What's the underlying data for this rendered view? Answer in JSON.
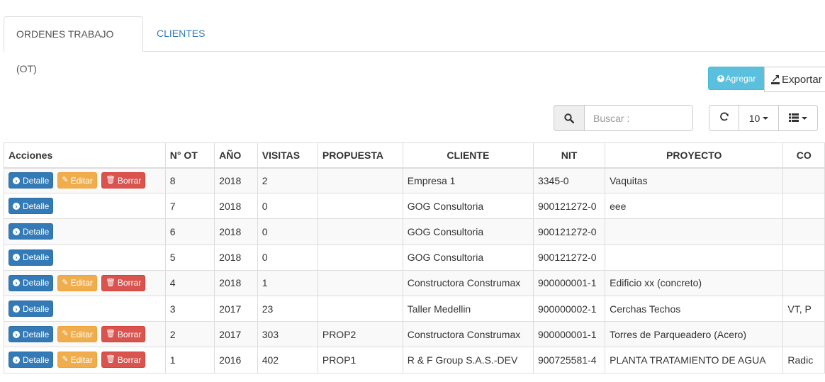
{
  "tabs": [
    {
      "label": "ORDENES TRABAJO (OT)",
      "active": true
    },
    {
      "label": "CLIENTES",
      "active": false
    }
  ],
  "toolbar": {
    "agregar_label": "Agregar",
    "exportar_label": "Exportar",
    "search_placeholder": "Buscar :",
    "page_size": "10"
  },
  "table": {
    "headers": [
      "Acciones",
      "N° OT",
      "AÑO",
      "VISITAS",
      "PROPUESTA",
      "CLIENTE",
      "NIT",
      "PROYECTO",
      "CO"
    ],
    "action_labels": {
      "detalle": "Detalle",
      "editar": "Editar",
      "borrar": "Borrar"
    },
    "rows": [
      {
        "editable": true,
        "ot": "8",
        "anio": "2018",
        "visitas": "2",
        "propuesta": "",
        "cliente": "Empresa 1",
        "nit": "3345-0",
        "proyecto": "Vaquitas",
        "co": ""
      },
      {
        "editable": false,
        "ot": "7",
        "anio": "2018",
        "visitas": "0",
        "propuesta": "",
        "cliente": "GOG Consultoria",
        "nit": "900121272-0",
        "proyecto": "eee",
        "co": ""
      },
      {
        "editable": false,
        "ot": "6",
        "anio": "2018",
        "visitas": "0",
        "propuesta": "",
        "cliente": "GOG Consultoria",
        "nit": "900121272-0",
        "proyecto": "",
        "co": ""
      },
      {
        "editable": false,
        "ot": "5",
        "anio": "2018",
        "visitas": "0",
        "propuesta": "",
        "cliente": "GOG Consultoria",
        "nit": "900121272-0",
        "proyecto": "",
        "co": ""
      },
      {
        "editable": true,
        "ot": "4",
        "anio": "2018",
        "visitas": "1",
        "propuesta": "",
        "cliente": "Constructora Construmax",
        "nit": "900000001-1",
        "proyecto": "Edificio xx (concreto)",
        "co": ""
      },
      {
        "editable": false,
        "ot": "3",
        "anio": "2017",
        "visitas": "23",
        "propuesta": "",
        "cliente": "Taller Medellin",
        "nit": "900000002-1",
        "proyecto": "Cerchas Techos",
        "co": "VT, P"
      },
      {
        "editable": true,
        "ot": "2",
        "anio": "2017",
        "visitas": "303",
        "propuesta": "PROP2",
        "cliente": "Constructora Construmax",
        "nit": "900000001-1",
        "proyecto": "Torres de Parqueadero (Acero)",
        "co": ""
      },
      {
        "editable": true,
        "ot": "1",
        "anio": "2016",
        "visitas": "402",
        "propuesta": "PROP1",
        "cliente": "R & F Group S.A.S.-DEV",
        "nit": "900725581-4",
        "proyecto": "PLANTA TRATAMIENTO DE AGUA",
        "co": "Radic"
      }
    ]
  },
  "colors": {
    "info": "#5bc0de",
    "primary": "#337ab7",
    "warning": "#f0ad4e",
    "danger": "#d9534f",
    "border": "#dddddd"
  }
}
